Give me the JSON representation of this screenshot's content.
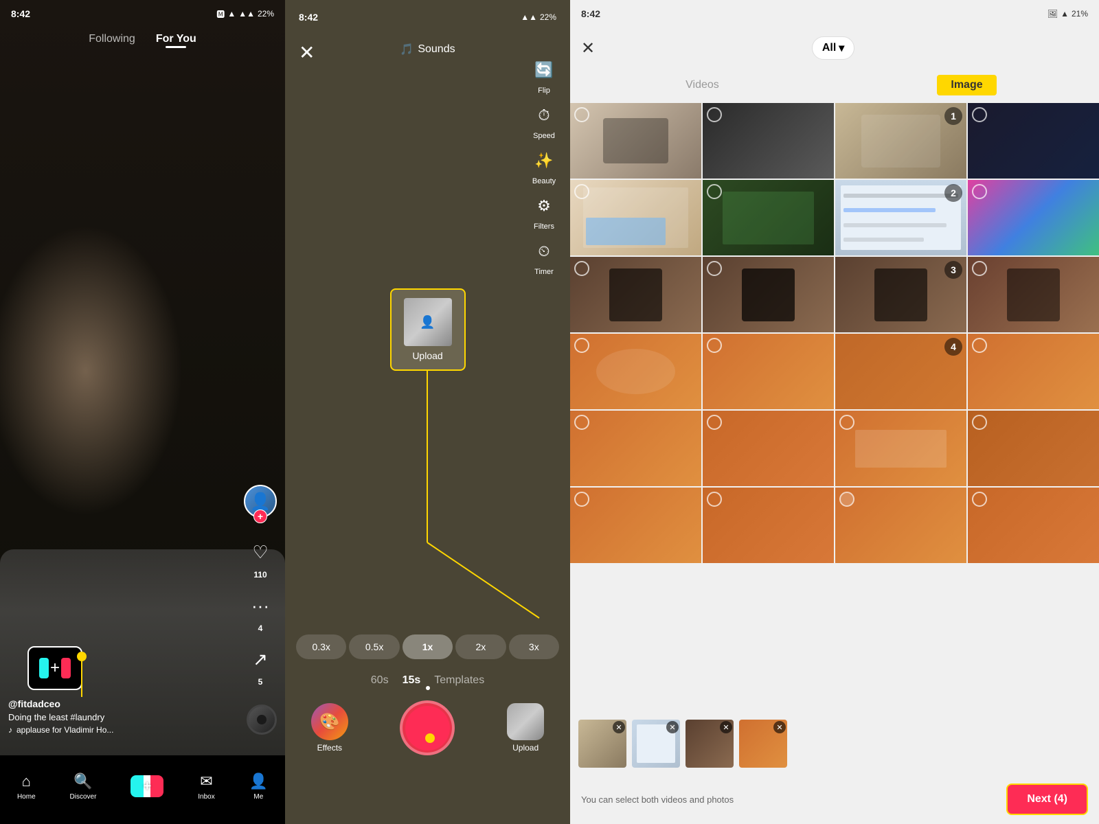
{
  "panel1": {
    "status_time": "8:42",
    "tab_following": "Following",
    "tab_foryou": "For You",
    "likes": "110",
    "comments": "4",
    "shares": "5",
    "username": "@fitdadceo",
    "caption": "Doing the least #laundry",
    "sound": "applause for Vladimir Ho...",
    "nav_home": "Home",
    "nav_discover": "Discover",
    "nav_inbox": "Inbox",
    "nav_me": "Me"
  },
  "panel2": {
    "status_time": "8:42",
    "sounds_label": "Sounds",
    "flip_label": "Flip",
    "speed_label": "Speed",
    "beauty_label": "Beauty",
    "filters_label": "Filters",
    "timer_label": "Timer",
    "upload_label": "Upload",
    "effects_label": "Effects",
    "speed_options": [
      "0.3x",
      "0.5x",
      "1x",
      "2x",
      "3x"
    ],
    "active_speed": "1x",
    "timer_tabs": [
      "60s",
      "15s",
      "Templates"
    ],
    "active_timer": "15s"
  },
  "panel3": {
    "status_time": "8:42",
    "close_label": "×",
    "all_label": "All",
    "tab_videos": "Videos",
    "tab_image": "Image",
    "selected_count": 4,
    "next_label": "Next (4)",
    "hint": "You can select both videos and photos",
    "selection_numbers": [
      "1",
      "2",
      "3",
      "4"
    ]
  }
}
